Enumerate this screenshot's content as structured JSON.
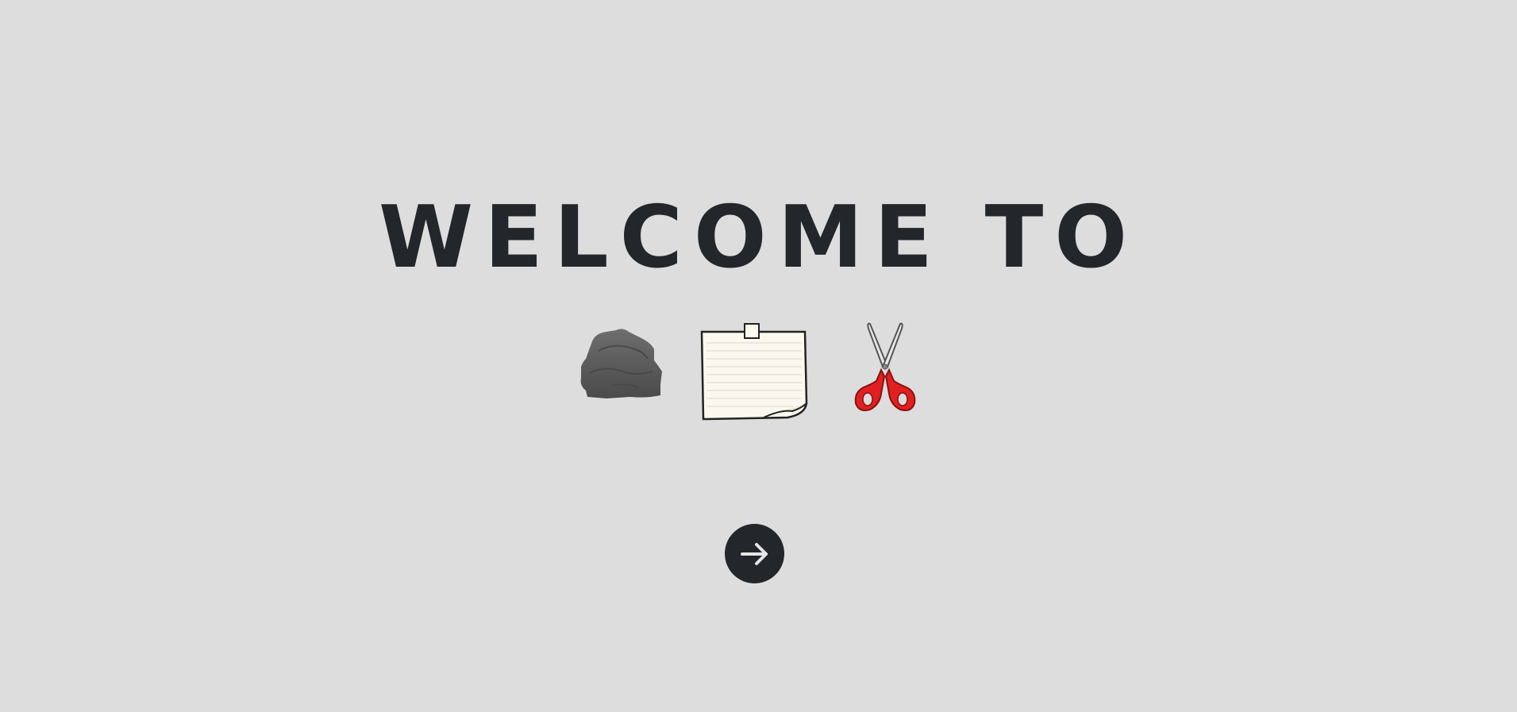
{
  "welcome": {
    "title": "WELCOME TO"
  },
  "icons": [
    {
      "name": "rock-icon",
      "color": "#5a5a5a"
    },
    {
      "name": "paper-icon",
      "color": "#fbf9ef"
    },
    {
      "name": "scissors-icon",
      "color": "#e02020"
    }
  ],
  "next_button": {
    "icon": "arrow-right-icon",
    "background": "#23262b"
  },
  "colors": {
    "background": "#dddddd",
    "text": "#23262b"
  }
}
